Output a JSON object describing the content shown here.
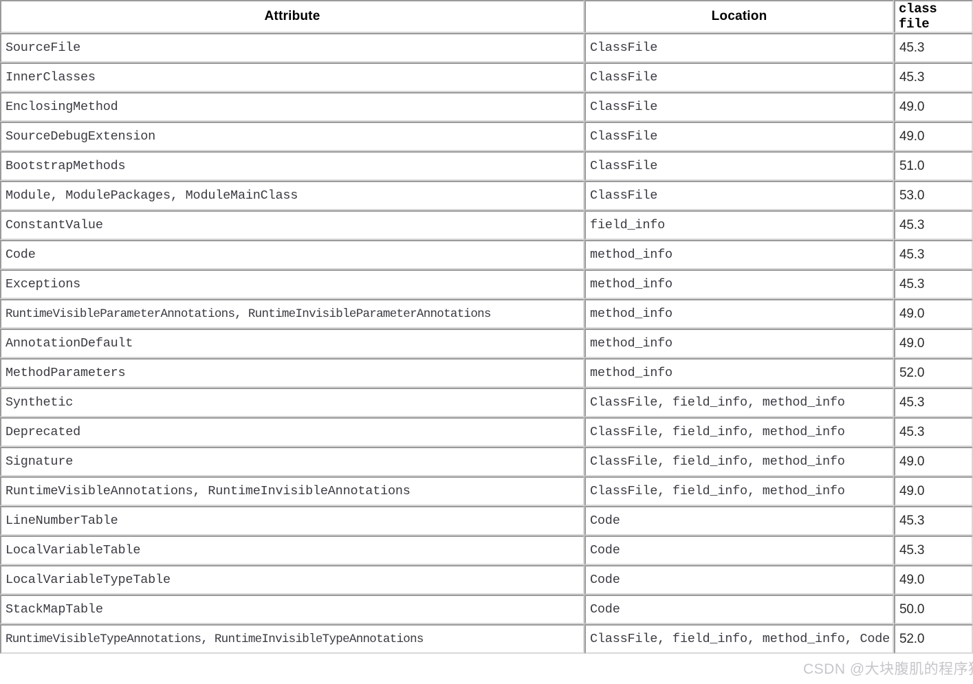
{
  "table": {
    "headers": {
      "attribute": "Attribute",
      "location": "Location",
      "version": "class file"
    },
    "rows": [
      {
        "attribute": "SourceFile",
        "location": "ClassFile",
        "version": "45.3",
        "tall": false
      },
      {
        "attribute": "InnerClasses",
        "location": "ClassFile",
        "version": "45.3",
        "tall": false
      },
      {
        "attribute": "EnclosingMethod",
        "location": "ClassFile",
        "version": "49.0",
        "tall": false
      },
      {
        "attribute": "SourceDebugExtension",
        "location": "ClassFile",
        "version": "49.0",
        "tall": false
      },
      {
        "attribute": "BootstrapMethods",
        "location": "ClassFile",
        "version": "51.0",
        "tall": false
      },
      {
        "attribute": "Module, ModulePackages, ModuleMainClass",
        "location": "ClassFile",
        "version": "53.0",
        "tall": true
      },
      {
        "attribute": "ConstantValue",
        "location": "field_info",
        "version": "45.3",
        "tall": false
      },
      {
        "attribute": "Code",
        "location": "method_info",
        "version": "45.3",
        "tall": false
      },
      {
        "attribute": "Exceptions",
        "location": "method_info",
        "version": "45.3",
        "tall": false
      },
      {
        "attribute": "RuntimeVisibleParameterAnnotations, RuntimeInvisibleParameterAnnotations",
        "location": "method_info",
        "version": "49.0",
        "tall": false
      },
      {
        "attribute": "AnnotationDefault",
        "location": "method_info",
        "version": "49.0",
        "tall": false
      },
      {
        "attribute": "MethodParameters",
        "location": "method_info",
        "version": "52.0",
        "tall": false
      },
      {
        "attribute": "Synthetic",
        "location": "ClassFile, field_info, method_info",
        "version": "45.3",
        "tall": false
      },
      {
        "attribute": "Deprecated",
        "location": "ClassFile, field_info, method_info",
        "version": "45.3",
        "tall": false
      },
      {
        "attribute": "Signature",
        "location": "ClassFile, field_info, method_info",
        "version": "49.0",
        "tall": false
      },
      {
        "attribute": "RuntimeVisibleAnnotations, RuntimeInvisibleAnnotations",
        "location": "ClassFile, field_info, method_info",
        "version": "49.0",
        "tall": false
      },
      {
        "attribute": "LineNumberTable",
        "location": "Code",
        "version": "45.3",
        "tall": false
      },
      {
        "attribute": "LocalVariableTable",
        "location": "Code",
        "version": "45.3",
        "tall": false
      },
      {
        "attribute": "LocalVariableTypeTable",
        "location": "Code",
        "version": "49.0",
        "tall": false
      },
      {
        "attribute": "StackMapTable",
        "location": "Code",
        "version": "50.0",
        "tall": false
      },
      {
        "attribute": "RuntimeVisibleTypeAnnotations, RuntimeInvisibleTypeAnnotations",
        "location": "ClassFile, field_info, method_info, Code",
        "version": "52.0",
        "tall": false
      }
    ]
  },
  "watermark": {
    "text": "CSDN @大块腹肌的程序猿"
  }
}
